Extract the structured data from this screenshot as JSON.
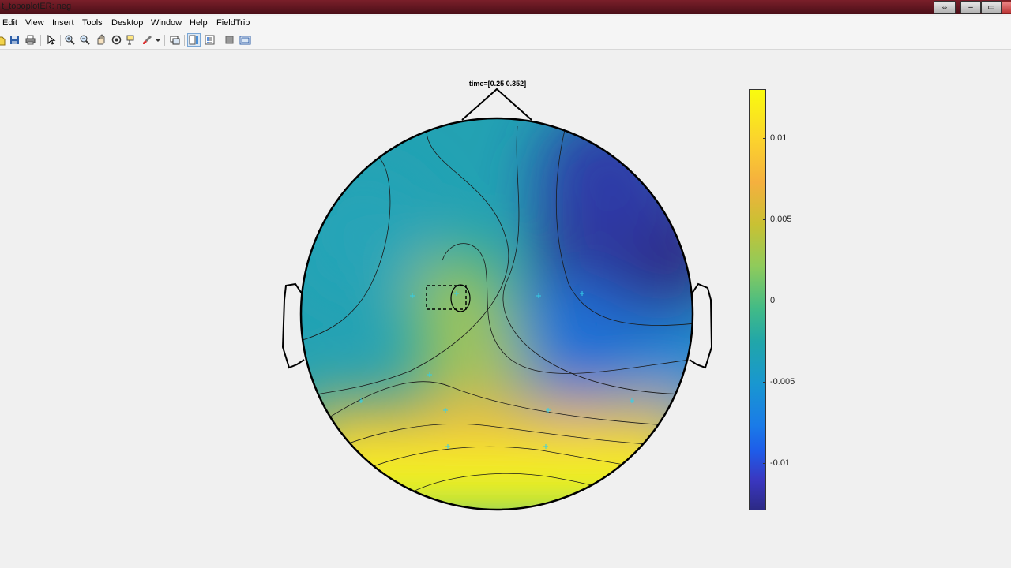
{
  "window": {
    "title": "t_topoplotER: neg",
    "buttons": {
      "restore_arrows": "⇔",
      "minimize": "–",
      "maximize": "▭",
      "close": ""
    }
  },
  "menu": [
    "Edit",
    "View",
    "Insert",
    "Tools",
    "Desktop",
    "Window",
    "Help",
    "FieldTrip"
  ],
  "toolbar_icons": [
    "new-figure-icon",
    "save-icon",
    "print-icon",
    "pointer-icon",
    "zoom-in-icon",
    "zoom-out-icon",
    "pan-hand-icon",
    "rotate-3d-icon",
    "data-cursor-icon",
    "brush-icon",
    "brush-dropdown-icon",
    "link-plot-icon",
    "insert-colorbar-icon",
    "insert-legend-icon",
    "hide-plot-tools-icon",
    "show-plot-tools-icon"
  ],
  "plot": {
    "title": "time=[0.25 0.352]",
    "colormap": "parula",
    "colorbar": {
      "ticks": [
        "0.01",
        "0.005",
        "0",
        "-0.005",
        "-0.01"
      ],
      "range": [
        -0.0131,
        0.0128
      ]
    }
  }
}
